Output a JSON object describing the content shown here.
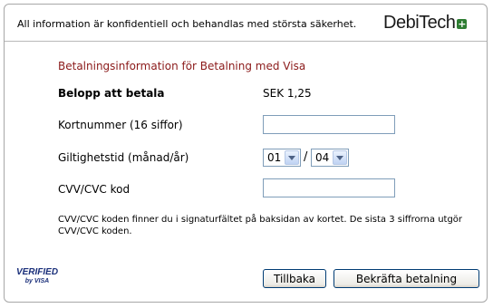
{
  "header": {
    "notice": "All information är konfidentiell och behandlas med största säkerhet.",
    "logo_text": "DebiTech",
    "logo_mark": "+",
    "logo_mark_color": "#2e7d32"
  },
  "form": {
    "title": "Betalningsinformation för Betalning med Visa",
    "title_color": "#8b1a1a",
    "amount_label": "Belopp att betala",
    "amount_value": "SEK 1,25",
    "card_number_label": "Kortnummer (16 siffor)",
    "card_number_value": "",
    "expiry_label": "Giltighetstid (månad/år)",
    "expiry_month": "01",
    "expiry_separator": "/",
    "expiry_year": "04",
    "cvv_label": "CVV/CVC kod",
    "cvv_value": "",
    "help_text": "CVV/CVC koden finner du i signaturfältet på baksidan av kortet. De sista 3 siffrorna utgör CVV/CVC koden."
  },
  "footer": {
    "verified_top": "VERIFIED",
    "verified_bottom": "by VISA",
    "back_label": "Tillbaka",
    "confirm_label": "Bekräfta betalning"
  }
}
